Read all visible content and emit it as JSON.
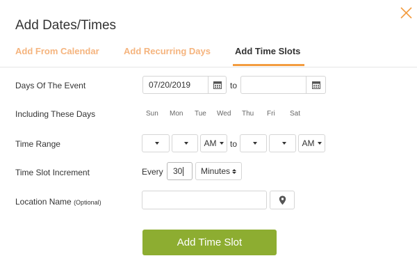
{
  "dialog": {
    "title": "Add Dates/Times"
  },
  "tabs": [
    {
      "label": "Add From Calendar",
      "active": false
    },
    {
      "label": "Add Recurring Days",
      "active": false
    },
    {
      "label": "Add Time Slots",
      "active": true
    }
  ],
  "days_of_event": {
    "label": "Days Of The Event",
    "start_value": "07/20/2019",
    "to_label": "to",
    "end_value": ""
  },
  "including_days": {
    "label": "Including These Days",
    "days": [
      "Sun",
      "Mon",
      "Tue",
      "Wed",
      "Thu",
      "Fri",
      "Sat"
    ]
  },
  "time_range": {
    "label": "Time Range",
    "start_hour": "",
    "start_minute": "",
    "start_ampm": "AM",
    "to_label": "to",
    "end_hour": "",
    "end_minute": "",
    "end_ampm": "AM"
  },
  "increment": {
    "label": "Time Slot Increment",
    "every_label": "Every",
    "value": "30",
    "unit": "Minutes"
  },
  "location": {
    "label": "Location Name",
    "optional_label": "(Optional)",
    "value": ""
  },
  "submit": {
    "label": "Add Time Slot"
  },
  "colors": {
    "accent_orange": "#f39c3f",
    "inactive_tab": "#f5b47e",
    "button_green": "#8dad31"
  },
  "icons": {
    "close": "close-icon",
    "calendar": "calendar-icon",
    "location": "map-pin-icon"
  }
}
